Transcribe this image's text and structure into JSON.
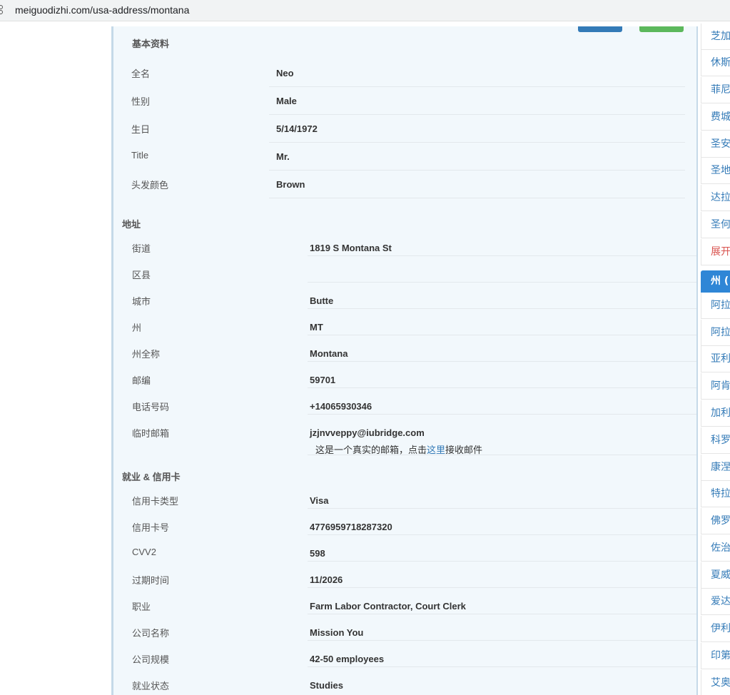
{
  "browser": {
    "url": "meiguodizhi.com/usa-address/montana"
  },
  "sections": {
    "basic": {
      "title": "基本资料",
      "rows": [
        {
          "label": "全名",
          "value": "Neo"
        },
        {
          "label": "性别",
          "value": "Male"
        },
        {
          "label": "生日",
          "value": "5/14/1972"
        },
        {
          "label": "Title",
          "value": "Mr."
        },
        {
          "label": "头发颜色",
          "value": "Brown"
        }
      ]
    },
    "address": {
      "title": "地址",
      "rows": [
        {
          "label": "街道",
          "value": "1819 S Montana St"
        },
        {
          "label": "区县",
          "value": ""
        },
        {
          "label": "城市",
          "value": "Butte"
        },
        {
          "label": "州",
          "value": "MT"
        },
        {
          "label": "州全称",
          "value": "Montana"
        },
        {
          "label": "邮编",
          "value": "59701"
        },
        {
          "label": "电话号码",
          "value": "+14065930346"
        },
        {
          "label": "临时邮箱",
          "value": "jzjnvveppy@iubridge.com"
        }
      ],
      "email_note_prefix": "这是一个真实的邮箱，点击",
      "email_note_link": "这里",
      "email_note_suffix": "接收邮件"
    },
    "employment": {
      "title": "就业 & 信用卡",
      "rows": [
        {
          "label": "信用卡类型",
          "value": "Visa"
        },
        {
          "label": "信用卡号",
          "value": "4776959718287320"
        },
        {
          "label": "CVV2",
          "value": "598"
        },
        {
          "label": "过期时间",
          "value": "11/2026"
        },
        {
          "label": "职业",
          "value": "Farm Labor Contractor, Court Clerk"
        },
        {
          "label": "公司名称",
          "value": "Mission You"
        },
        {
          "label": "公司规模",
          "value": "42-50 employees"
        },
        {
          "label": "就业状态",
          "value": "Studies"
        }
      ]
    }
  },
  "sidebar": {
    "cities": [
      "芝加",
      "休斯",
      "菲尼",
      "费城",
      "圣安",
      "圣地",
      "达拉",
      "圣何"
    ],
    "expand": "展开",
    "states_header": "州 (",
    "states": [
      "阿拉",
      "阿拉",
      "亚利",
      "阿肯",
      "加利",
      "科罗",
      "康涅",
      "特拉",
      "佛罗",
      "佐治",
      "夏威",
      "爱达",
      "伊利",
      "印第",
      "艾奥"
    ]
  }
}
